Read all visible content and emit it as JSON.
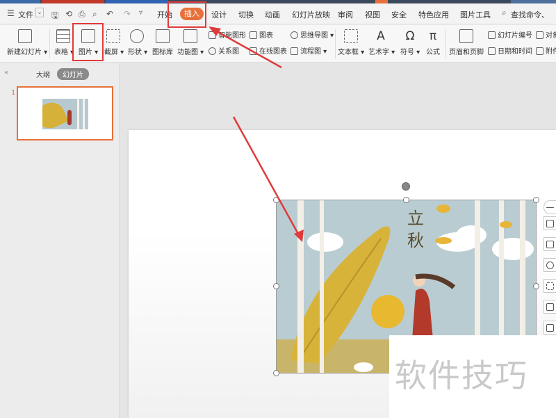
{
  "menubar": {
    "file_label": "文件",
    "tabs": [
      "开始",
      "插入",
      "设计",
      "切换",
      "动画",
      "幻灯片放映",
      "审阅",
      "视图",
      "安全",
      "特色应用",
      "图片工具"
    ],
    "active_tab": "插入",
    "search_label": "查找命令、"
  },
  "ribbon": {
    "new_slide": "新建幻灯片",
    "table": "表格",
    "picture": "图片",
    "screenshot": "截屏",
    "shape": "形状",
    "icon_lib": "图标库",
    "func_chart": "功能图",
    "smart_shape": "智能图形",
    "chart": "图表",
    "relation": "关系图",
    "online_chart": "在线图表",
    "mindmap": "思维导图",
    "flowchart": "流程图",
    "textbox": "文本框",
    "wordart": "艺术字",
    "symbol": "符号",
    "formula": "公式",
    "header_footer": "页眉和页脚",
    "slide_number": "幻灯片编号",
    "datetime": "日期和时间",
    "obj": "对象",
    "attach": "附件"
  },
  "leftpanel": {
    "outline_tab": "大纲",
    "slides_tab": "幻灯片",
    "slide_number": "1"
  },
  "picture": {
    "title_chars": [
      "立",
      "秋"
    ]
  },
  "watermark": "软件技巧",
  "colors": {
    "accent": "#e8703a",
    "annotation_red": "#e03a3a"
  }
}
